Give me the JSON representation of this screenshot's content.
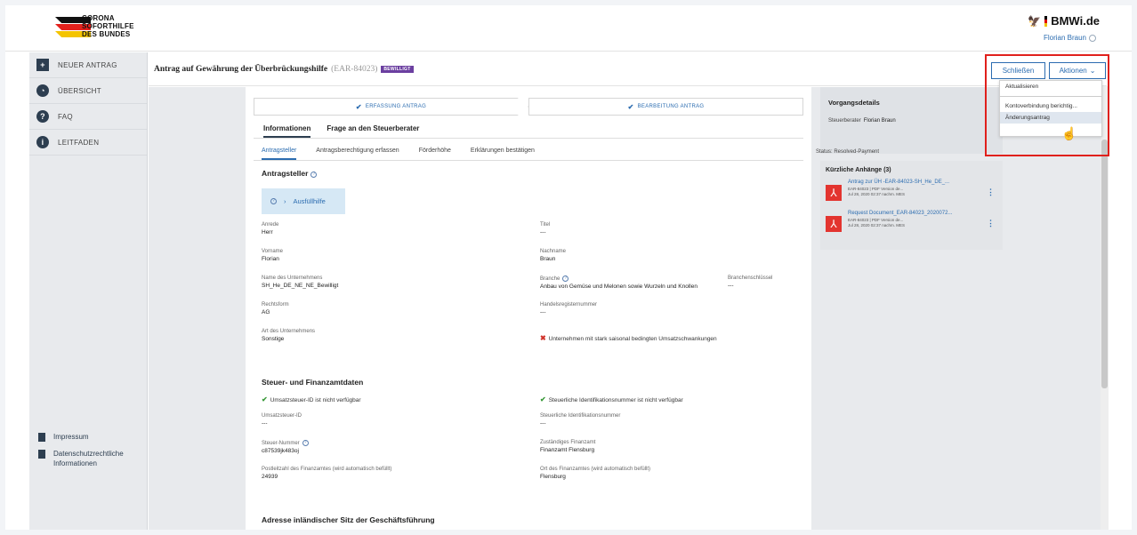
{
  "colors": {
    "accent": "#2b6cb0",
    "sidebar_bg": "#e8eaed",
    "badge": "#6b3fa0",
    "highlight_box": "#e0201c",
    "pdf": "#e3342f"
  },
  "logo": {
    "lines": [
      "CORONA",
      "SOFORTHILFE",
      "DES BUNDES"
    ]
  },
  "ministry": {
    "name": "BMWi.de",
    "user": "Florian Braun"
  },
  "sidebar": {
    "items": [
      {
        "icon": "plus-icon",
        "label": "NEUER ANTRAG"
      },
      {
        "icon": "overview-icon",
        "label": "ÜBERSICHT"
      },
      {
        "icon": "question-icon",
        "label": "FAQ"
      },
      {
        "icon": "info-icon",
        "label": "LEITFADEN"
      }
    ],
    "footer_links": [
      {
        "label": "Impressum"
      },
      {
        "label": "Datenschutzrechtliche Informationen"
      }
    ]
  },
  "page": {
    "title": "Antrag auf Gewährung der Überbrückungshilfe",
    "id": "(EAR-84023)",
    "badge": "BEWILLIGT",
    "close_label": "Schließen",
    "actions_label": "Aktionen"
  },
  "dropdown": {
    "items": [
      "Aktualisieren",
      "Kontoverbindung berichtig...",
      "Änderungsantrag"
    ]
  },
  "steps": [
    "ERFASSUNG ANTRAG",
    "BEARBEITUNG ANTRAG"
  ],
  "tabs_main": [
    "Informationen",
    "Frage an den Steuerberater"
  ],
  "tabs_sub": [
    "Antragsteller",
    "Antragsberechtigung erfassen",
    "Förderhöhe",
    "Erklärungen bestätigen"
  ],
  "antragsteller": {
    "title": "Antragsteller",
    "fill_help": "Ausfüllhilfe",
    "fields": {
      "anrede": {
        "label": "Anrede",
        "value": "Herr"
      },
      "titel": {
        "label": "Titel",
        "value": "---"
      },
      "vorname": {
        "label": "Vorname",
        "value": "Florian"
      },
      "nachname": {
        "label": "Nachname",
        "value": "Braun"
      },
      "unternehmen": {
        "label": "Name des Unternehmens",
        "value": "SH_He_DE_NE_NE_Bewilligt"
      },
      "branche": {
        "label": "Branche",
        "value": "Anbau von Gemüse und Melonen sowie Wurzeln und Knollen"
      },
      "branchenschluessel": {
        "label": "Branchenschlüssel",
        "value": "---"
      },
      "rechtsform": {
        "label": "Rechtsform",
        "value": "AG"
      },
      "handelsregister": {
        "label": "Handelsregisternummer",
        "value": "---"
      },
      "art": {
        "label": "Art des Unternehmens",
        "value": "Sonstige"
      }
    },
    "seasonal_note": "Unternehmen mit stark saisonal bedingten Umsatzschwankungen"
  },
  "steuer": {
    "title": "Steuer- und Finanzamtdaten",
    "check1": "Umsatzsteuer-ID ist nicht verfügbar",
    "check2": "Steuerliche Identifikationsnummer ist nicht verfügbar",
    "fields": {
      "ustid": {
        "label": "Umsatzsteuer-ID",
        "value": "---"
      },
      "steuerid": {
        "label": "Steuerliche Identifikationsnummer",
        "value": "---"
      },
      "steuernummer": {
        "label": "Steuer-Nummer",
        "value": "c87539jk483oj"
      },
      "finanzamt": {
        "label": "Zuständiges Finanzamt",
        "value": "Finanzamt Flensburg"
      },
      "plz": {
        "label": "Postleitzahl des Finanzamtes (wird automatisch befüllt)",
        "value": "24939"
      },
      "ort": {
        "label": "Ort des Finanzamtes (wird automatisch befüllt)",
        "value": "Flensburg"
      }
    }
  },
  "adresse": {
    "title": "Adresse inländischer Sitz der Geschäftsführung"
  },
  "vorgang": {
    "title": "Vorgangsdetails",
    "steuerberater_label": "Steuerberater",
    "steuerberater_value": "Florian Braun",
    "status": "Status: Resolved-Payment"
  },
  "attachments": {
    "title": "Kürzliche Anhänge (3)",
    "items": [
      {
        "name": "Antrag zur ÜH -EAR-84023-SH_He_DE_...",
        "meta1": "EAR-84023 | PDF Version de...",
        "meta2": "Jul 28, 2020 02:37 nachm. MES"
      },
      {
        "name": "Request Document_EAR-84023_2020072...",
        "meta1": "EAR-84023 | PDF Version de...",
        "meta2": "Jul 28, 2020 02:37 nachm. MES"
      }
    ]
  }
}
